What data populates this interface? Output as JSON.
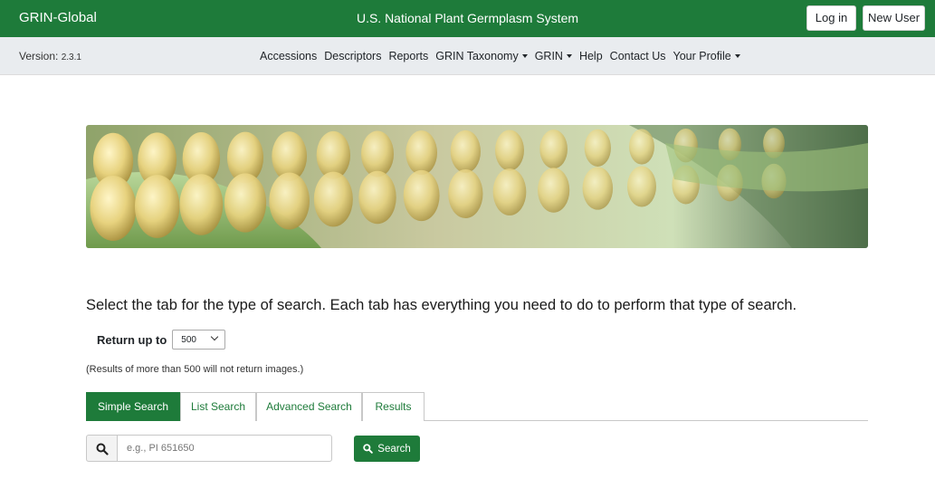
{
  "header": {
    "brand": "GRIN-Global",
    "site_title": "U.S. National Plant Germplasm System",
    "login_label": "Log in",
    "new_user_label": "New User",
    "color": "#1e7b3a"
  },
  "navbar": {
    "version_label": "Version:",
    "version_number": "2.3.1",
    "links": [
      {
        "label": "Accessions",
        "dropdown": false
      },
      {
        "label": "Descriptors",
        "dropdown": false
      },
      {
        "label": "Reports",
        "dropdown": false
      },
      {
        "label": "GRIN Taxonomy",
        "dropdown": true
      },
      {
        "label": "GRIN",
        "dropdown": true
      },
      {
        "label": "Help",
        "dropdown": false
      },
      {
        "label": "Contact Us",
        "dropdown": false
      },
      {
        "label": "Your Profile",
        "dropdown": true
      }
    ]
  },
  "main": {
    "instructions": "Select the tab for the type of search. Each tab has everything you need to do to perform that type of search.",
    "return_label": "Return up to",
    "return_value": "500",
    "note": "(Results of more than 500 will not return images.)",
    "tabs": [
      {
        "label": "Simple Search",
        "active": true
      },
      {
        "label": "List Search",
        "active": false
      },
      {
        "label": "Advanced Search",
        "active": false
      },
      {
        "label": "Results",
        "active": false
      }
    ],
    "search": {
      "placeholder": "e.g., PI 651650",
      "button_label": "Search",
      "icon": "search-icon"
    }
  }
}
